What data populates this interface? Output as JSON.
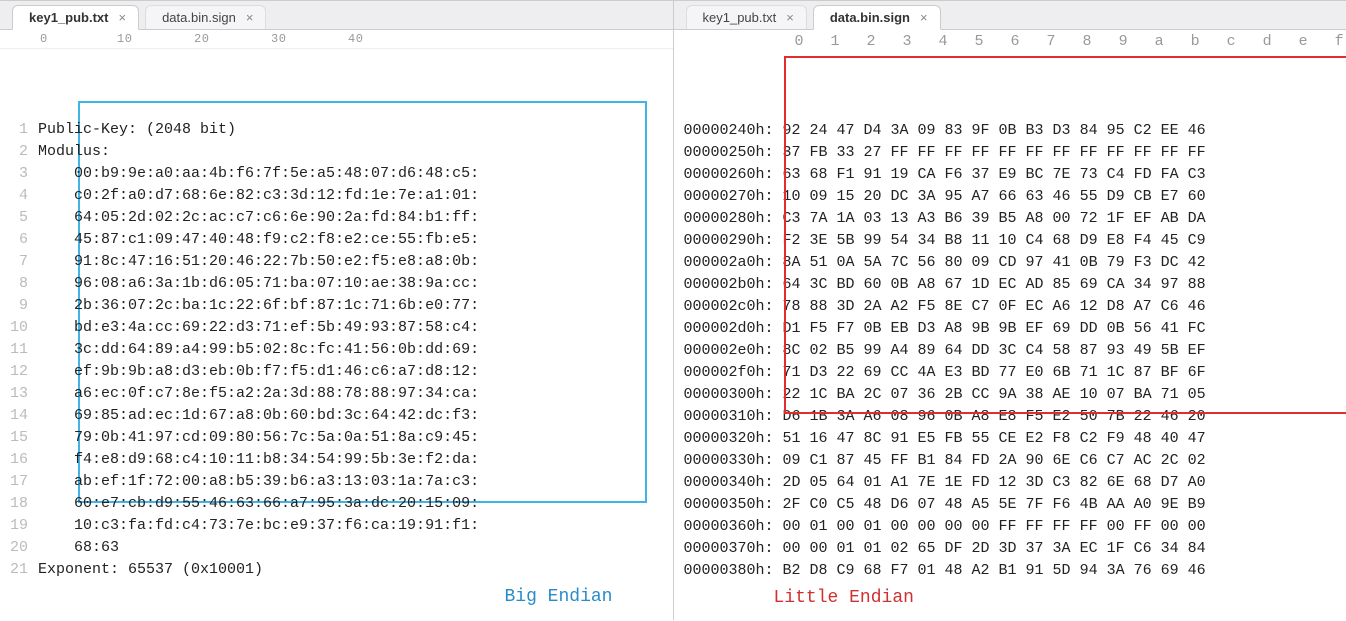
{
  "left": {
    "tabs": [
      {
        "label": "key1_pub.txt",
        "active": true
      },
      {
        "label": "data.bin.sign",
        "active": false
      }
    ],
    "ruler": "0         10        20        30        40        ",
    "lines": [
      {
        "n": "1",
        "text": "Public-Key: (2048 bit)"
      },
      {
        "n": "2",
        "text": "Modulus:"
      },
      {
        "n": "3",
        "text": "    00:b9:9e:a0:aa:4b:f6:7f:5e:a5:48:07:d6:48:c5:"
      },
      {
        "n": "4",
        "text": "    c0:2f:a0:d7:68:6e:82:c3:3d:12:fd:1e:7e:a1:01:"
      },
      {
        "n": "5",
        "text": "    64:05:2d:02:2c:ac:c7:c6:6e:90:2a:fd:84:b1:ff:"
      },
      {
        "n": "6",
        "text": "    45:87:c1:09:47:40:48:f9:c2:f8:e2:ce:55:fb:e5:"
      },
      {
        "n": "7",
        "text": "    91:8c:47:16:51:20:46:22:7b:50:e2:f5:e8:a8:0b:"
      },
      {
        "n": "8",
        "text": "    96:08:a6:3a:1b:d6:05:71:ba:07:10:ae:38:9a:cc:"
      },
      {
        "n": "9",
        "text": "    2b:36:07:2c:ba:1c:22:6f:bf:87:1c:71:6b:e0:77:"
      },
      {
        "n": "10",
        "text": "    bd:e3:4a:cc:69:22:d3:71:ef:5b:49:93:87:58:c4:"
      },
      {
        "n": "11",
        "text": "    3c:dd:64:89:a4:99:b5:02:8c:fc:41:56:0b:dd:69:"
      },
      {
        "n": "12",
        "text": "    ef:9b:9b:a8:d3:eb:0b:f7:f5:d1:46:c6:a7:d8:12:"
      },
      {
        "n": "13",
        "text": "    a6:ec:0f:c7:8e:f5:a2:2a:3d:88:78:88:97:34:ca:"
      },
      {
        "n": "14",
        "text": "    69:85:ad:ec:1d:67:a8:0b:60:bd:3c:64:42:dc:f3:"
      },
      {
        "n": "15",
        "text": "    79:0b:41:97:cd:09:80:56:7c:5a:0a:51:8a:c9:45:"
      },
      {
        "n": "16",
        "text": "    f4:e8:d9:68:c4:10:11:b8:34:54:99:5b:3e:f2:da:"
      },
      {
        "n": "17",
        "text": "    ab:ef:1f:72:00:a8:b5:39:b6:a3:13:03:1a:7a:c3:"
      },
      {
        "n": "18",
        "text": "    60:e7:cb:d9:55:46:63:66:a7:95:3a:dc:20:15:09:"
      },
      {
        "n": "19",
        "text": "    10:c3:fa:fd:c4:73:7e:bc:e9:37:f6:ca:19:91:f1:"
      },
      {
        "n": "20",
        "text": "    68:63"
      },
      {
        "n": "21",
        "text": "Exponent: 65537 (0x10001)"
      }
    ],
    "caption": "Big Endian"
  },
  "right": {
    "tabs": [
      {
        "label": "key1_pub.txt",
        "active": false
      },
      {
        "label": "data.bin.sign",
        "active": true
      }
    ],
    "hex_header_cols": "         0   1   2   3   4   5   6   7   8   9   a   b   c   d   e   f",
    "hex_lines": [
      "00000240h: 92 24 47 D4 3A 09 83 9F 0B B3 D3 84 95 C2 EE 46",
      "00000250h: 37 FB 33 27 FF FF FF FF FF FF FF FF FF FF FF FF",
      "00000260h: 63 68 F1 91 19 CA F6 37 E9 BC 7E 73 C4 FD FA C3",
      "00000270h: 10 09 15 20 DC 3A 95 A7 66 63 46 55 D9 CB E7 60",
      "00000280h: C3 7A 1A 03 13 A3 B6 39 B5 A8 00 72 1F EF AB DA",
      "00000290h: F2 3E 5B 99 54 34 B8 11 10 C4 68 D9 E8 F4 45 C9",
      "000002a0h: 8A 51 0A 5A 7C 56 80 09 CD 97 41 0B 79 F3 DC 42",
      "000002b0h: 64 3C BD 60 0B A8 67 1D EC AD 85 69 CA 34 97 88",
      "000002c0h: 78 88 3D 2A A2 F5 8E C7 0F EC A6 12 D8 A7 C6 46",
      "000002d0h: D1 F5 F7 0B EB D3 A8 9B 9B EF 69 DD 0B 56 41 FC",
      "000002e0h: 8C 02 B5 99 A4 89 64 DD 3C C4 58 87 93 49 5B EF",
      "000002f0h: 71 D3 22 69 CC 4A E3 BD 77 E0 6B 71 1C 87 BF 6F",
      "00000300h: 22 1C BA 2C 07 36 2B CC 9A 38 AE 10 07 BA 71 05",
      "00000310h: D6 1B 3A A6 08 96 0B A8 E8 F5 E2 50 7B 22 46 20",
      "00000320h: 51 16 47 8C 91 E5 FB 55 CE E2 F8 C2 F9 48 40 47",
      "00000330h: 09 C1 87 45 FF B1 84 FD 2A 90 6E C6 C7 AC 2C 02",
      "00000340h: 2D 05 64 01 A1 7E 1E FD 12 3D C3 82 6E 68 D7 A0",
      "00000350h: 2F C0 C5 48 D6 07 48 A5 5E 7F F6 4B AA A0 9E B9",
      "00000360h: 00 01 00 01 00 00 00 00 FF FF FF FF 00 FF 00 00",
      "00000370h: 00 00 01 01 02 65 DF 2D 3D 37 3A EC 1F C6 34 84",
      "00000380h: B2 D8 C9 68 F7 01 48 A2 B1 91 5D 94 3A 76 69 46"
    ],
    "caption": "Little Endian"
  }
}
